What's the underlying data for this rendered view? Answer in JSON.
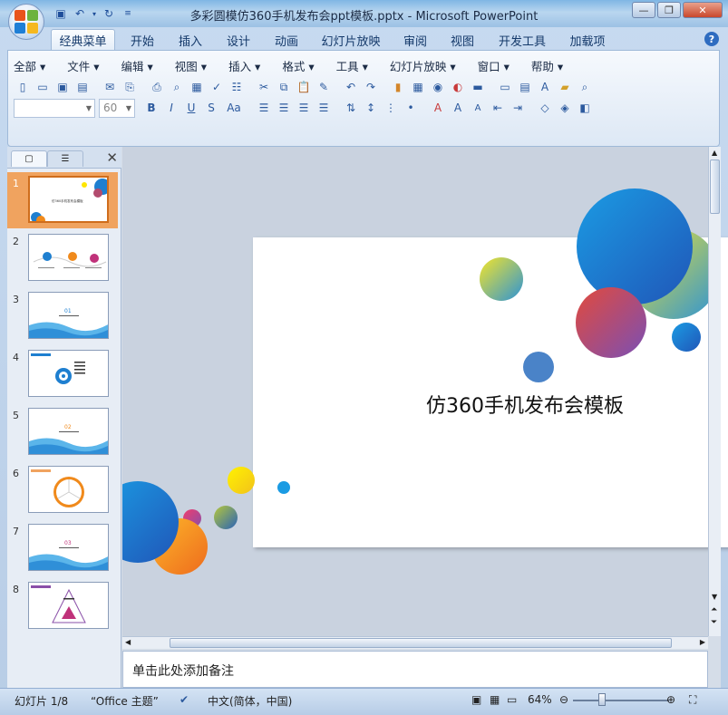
{
  "window": {
    "title": "多彩圆模仿360手机发布会ppt模板.pptx - Microsoft PowerPoint",
    "controls": [
      "minimize",
      "maximize",
      "close"
    ]
  },
  "quick_access": [
    "save-icon",
    "undo-icon",
    "dropdown-icon",
    "redo-icon",
    "customize-icon"
  ],
  "ribbon_tabs": [
    {
      "label": "经典菜单",
      "active": true
    },
    {
      "label": "开始"
    },
    {
      "label": "插入"
    },
    {
      "label": "设计"
    },
    {
      "label": "动画"
    },
    {
      "label": "幻灯片放映"
    },
    {
      "label": "审阅"
    },
    {
      "label": "视图"
    },
    {
      "label": "开发工具"
    },
    {
      "label": "加载项"
    }
  ],
  "classic_menu": [
    "全部",
    "文件",
    "编辑",
    "视图",
    "插入",
    "格式",
    "工具",
    "幻灯片放映",
    "窗口",
    "帮助"
  ],
  "toolbar": {
    "font_name": "",
    "font_size": "60"
  },
  "slides": [
    {
      "number": "1",
      "selected": true,
      "thumb_text": "仿360手机发布会模板"
    },
    {
      "number": "2",
      "thumb_text": ""
    },
    {
      "number": "3",
      "thumb_text": "01"
    },
    {
      "number": "4",
      "thumb_text": ""
    },
    {
      "number": "5",
      "thumb_text": "02"
    },
    {
      "number": "6",
      "thumb_text": ""
    },
    {
      "number": "7",
      "thumb_text": "03"
    },
    {
      "number": "8",
      "thumb_text": ""
    }
  ],
  "slide": {
    "title": "仿360手机发布会模板"
  },
  "notes_placeholder": "单击此处添加备注",
  "status": {
    "slide_index": "幻灯片 1/8",
    "theme": "“Office 主题”",
    "language": "中文(简体，中国)",
    "zoom": "64%"
  },
  "colors": {
    "accent_blue": "#1e7fd0",
    "accent_orange": "#f08a1c",
    "accent_yellow": "#ffe600",
    "accent_purple": "#8a4fa8",
    "selection_orange": "#f0a35f"
  }
}
